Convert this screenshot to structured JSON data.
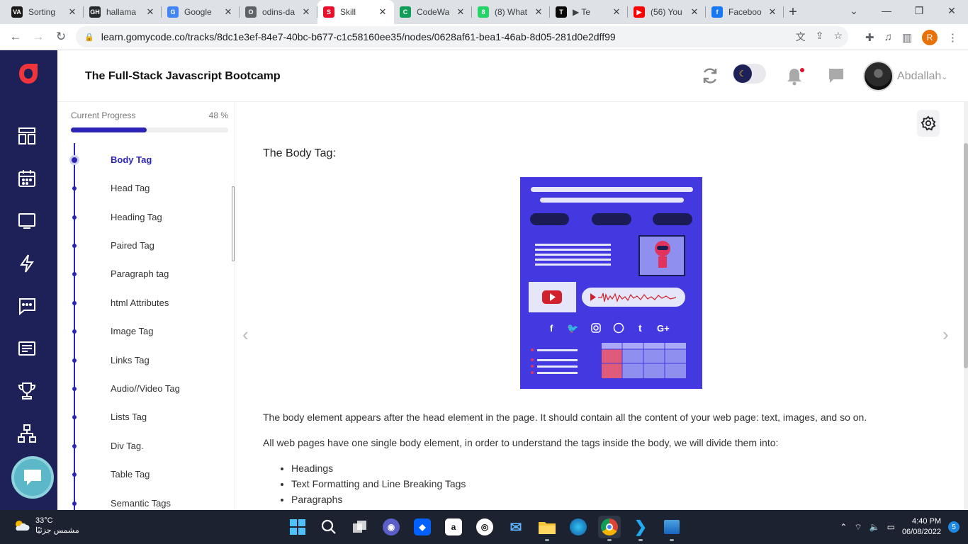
{
  "browser": {
    "tabs": [
      {
        "title": "Sorting",
        "favicon": "VA",
        "color": "#1a1a1a"
      },
      {
        "title": "hallama",
        "favicon": "GH",
        "color": "#24292e"
      },
      {
        "title": "Google",
        "favicon": "G",
        "color": "#4285f4"
      },
      {
        "title": "odins-da",
        "favicon": "O",
        "color": "#5f6368"
      },
      {
        "title": "Skill",
        "favicon": "S",
        "color": "#e8102a"
      },
      {
        "title": "CodeWa",
        "favicon": "C",
        "color": "#0f9d58"
      },
      {
        "title": "(8) What",
        "favicon": "8",
        "color": "#25d366"
      },
      {
        "title": "▶ Te",
        "favicon": "T",
        "color": "#0a0a0a"
      },
      {
        "title": "(56) You",
        "favicon": "▶",
        "color": "#ff0000"
      },
      {
        "title": "Faceboo",
        "favicon": "f",
        "color": "#1877f2"
      }
    ],
    "active_tab_index": 4,
    "url": "learn.gomycode.co/tracks/8dc1e3ef-84e7-40bc-b677-c1c58160ee35/nodes/0628af61-bea1-46ab-8d05-281d0e2dff99",
    "profile_initial": "R"
  },
  "header": {
    "course_title": "The Full-Stack Javascript Bootcamp",
    "username": "Abdallah"
  },
  "progress": {
    "label": "Current Progress",
    "value_text": "48 %",
    "value": 48
  },
  "lessons": [
    {
      "name": "Body Tag",
      "active": true
    },
    {
      "name": "Head Tag"
    },
    {
      "name": "Heading Tag"
    },
    {
      "name": "Paired Tag"
    },
    {
      "name": "Paragraph tag"
    },
    {
      "name": "html Attributes"
    },
    {
      "name": "Image Tag"
    },
    {
      "name": "Links Tag"
    },
    {
      "name": "Audio//Video Tag"
    },
    {
      "name": "Lists Tag"
    },
    {
      "name": "Div Tag."
    },
    {
      "name": "Table Tag"
    },
    {
      "name": "Semantic Tags"
    }
  ],
  "content": {
    "section_title": "The Body Tag:",
    "paragraph1": "The body element appears after the head element in the page. It should contain all the content of your web page: text, images, and so on.",
    "paragraph2": "All web pages have one single body element, in order to understand the tags inside the body, we will divide them into:",
    "bullets": [
      "Headings",
      "Text Formatting and Line Breaking Tags",
      "Paragraphs"
    ]
  },
  "taskbar": {
    "temperature": "33°C",
    "weather_text": "مشمس جزئيًا",
    "time": "4:40 PM",
    "date": "06/08/2022",
    "notifications": "5"
  }
}
